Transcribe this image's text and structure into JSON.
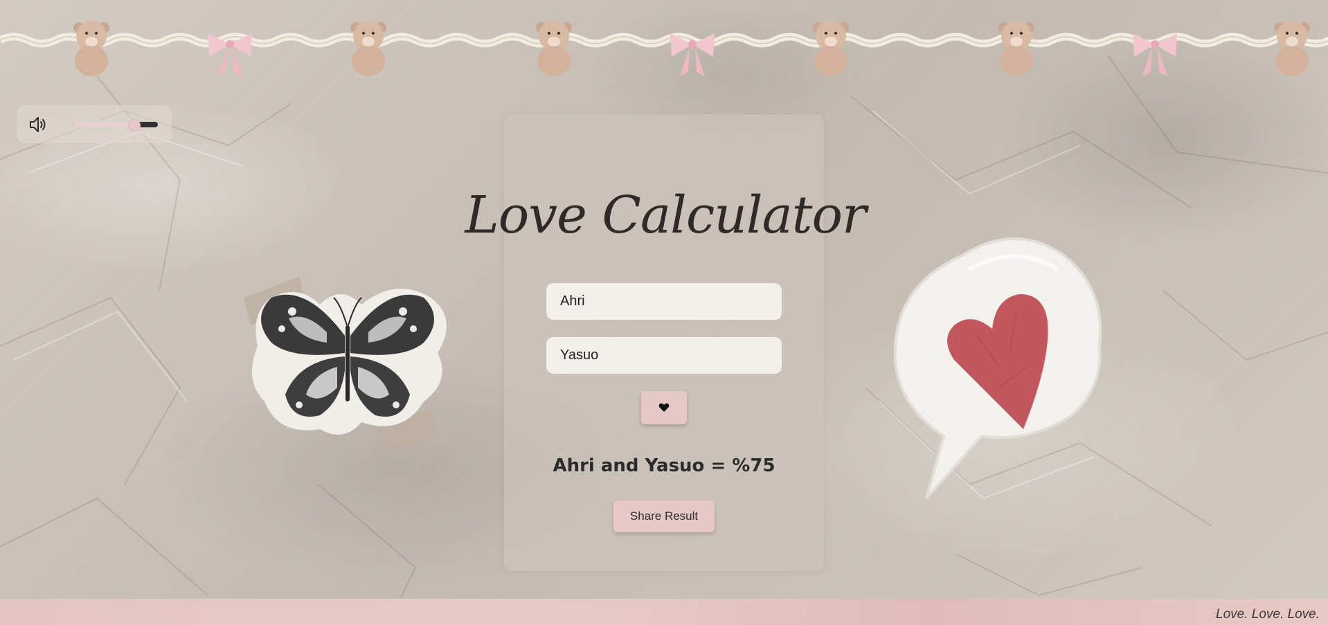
{
  "app": {
    "title": "Love Calculator"
  },
  "audio": {
    "icon": "speaker-icon",
    "volume_fraction": 0.72
  },
  "form": {
    "first_name_value": "Ahri",
    "second_name_value": "Yasuo",
    "calculate_icon": "heart-icon"
  },
  "result": {
    "text": "Ahri and Yasuo = %75"
  },
  "share": {
    "label": "Share Result"
  },
  "footer": {
    "text": "Love. Love. Love."
  },
  "colors": {
    "accent_pink": "#e6c8c6",
    "card_bg": "#cdc5bc",
    "text_dark": "#2b2b2b",
    "sticker_heart": "#c2585e"
  }
}
